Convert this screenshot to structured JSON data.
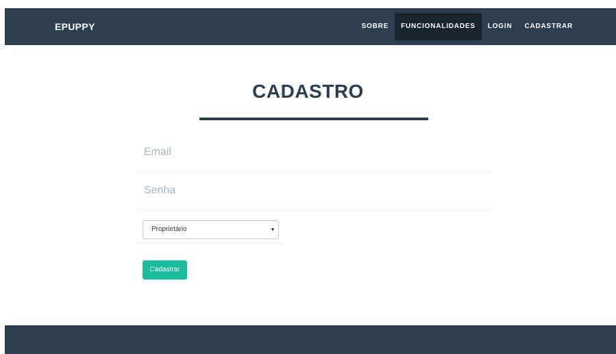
{
  "navbar": {
    "brand": "EPUPPY",
    "items": [
      {
        "label": "SOBRE",
        "active": false
      },
      {
        "label": "FUNCIONALIDADES",
        "active": true
      },
      {
        "label": "LOGIN",
        "active": false
      },
      {
        "label": "CADASTRAR",
        "active": false
      }
    ]
  },
  "main": {
    "title": "CADASTRO",
    "email": {
      "value": "",
      "placeholder": "Email"
    },
    "senha": {
      "value": "",
      "placeholder": "Senha"
    },
    "tipo": {
      "selected": "Proprietário"
    },
    "submit_label": "Cadastrar"
  },
  "colors": {
    "navbar_bg": "#2c3e50",
    "nav_active_bg": "#1a242f",
    "title": "#2c3e50",
    "button_bg": "#1abc9c"
  }
}
